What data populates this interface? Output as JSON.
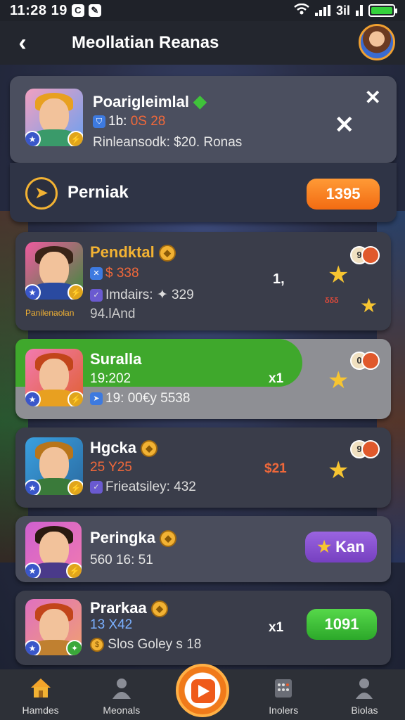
{
  "status_bar": {
    "time": "11:28 19",
    "carrier": "3il"
  },
  "header": {
    "title": "Meollatian Reanas"
  },
  "notification": {
    "name": "Poarigleimlal",
    "line1_prefix": "1b:",
    "line1_value": "0S 28",
    "line2": "Rinleansodk: $20. Ronas"
  },
  "pernak": {
    "label": "Perniak",
    "button": "1395"
  },
  "rows": [
    {
      "name": "Pendktal",
      "value": "$ 338",
      "stat": "Imdairs: ✦ 329",
      "sub": "94.lAnd",
      "caption": "Panilenaolan",
      "mid": "1,",
      "coin_badge": "9",
      "extra": "ᵟᵟᵟ"
    },
    {
      "name": "Suralla",
      "value": "19:202",
      "stat": "19: 00€y 5538",
      "mid": "x1",
      "coin_badge": "0"
    },
    {
      "name": "Hgcka",
      "value": "25 Y25",
      "stat": "Frieatsiley: 432",
      "mid": "$21",
      "coin_badge": "9"
    },
    {
      "name": "Peringka",
      "value": "560 16: 51",
      "button": "Kan"
    },
    {
      "name": "Prarkaa",
      "value": "13 X42",
      "stat": "Slos Goley s 18",
      "mid": "x1",
      "button": "1091"
    }
  ],
  "nav": {
    "tabs": [
      {
        "label": "Hamdes",
        "icon": "home-icon"
      },
      {
        "label": "Meonals",
        "icon": "person-icon"
      },
      {
        "label": "",
        "icon": "play-icon"
      },
      {
        "label": "Inolers",
        "icon": "grid-icon"
      },
      {
        "label": "Biolas",
        "icon": "profile-icon"
      }
    ]
  },
  "colors": {
    "accent": "#f2b233",
    "green": "#3fbf2a",
    "orange": "#f26b12",
    "purple": "#8652d0"
  }
}
